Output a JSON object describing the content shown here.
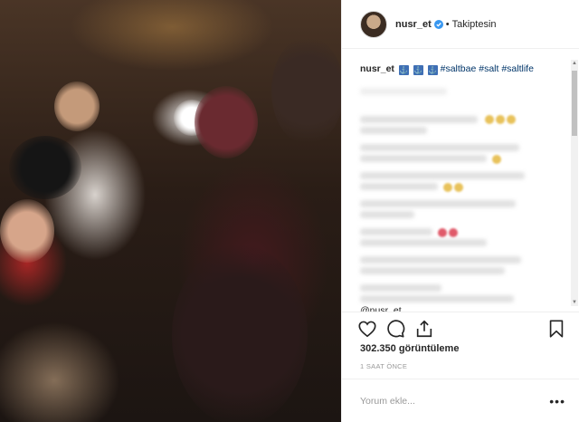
{
  "post": {
    "username": "nusr_et",
    "follow_status": "Takiptesin",
    "caption": {
      "user": "nusr_et",
      "flags": [
        "⚓",
        "⚓",
        "⚓"
      ],
      "hashtags": "#saltbae #salt #saltlife"
    },
    "mention": "@nusr_et",
    "views": "302.350 görüntüleme",
    "time_ago": "1 SAAT ÖNCE",
    "comment_placeholder": "Yorum ekle..."
  },
  "icons": {
    "verified": "verified-badge-icon",
    "like": "heart-icon",
    "comment": "comment-bubble-icon",
    "share": "share-icon",
    "save": "bookmark-icon",
    "more": "more-dots-icon"
  },
  "colors": {
    "hashtag": "#003569",
    "verified": "#3897f0",
    "muted": "#999999"
  }
}
